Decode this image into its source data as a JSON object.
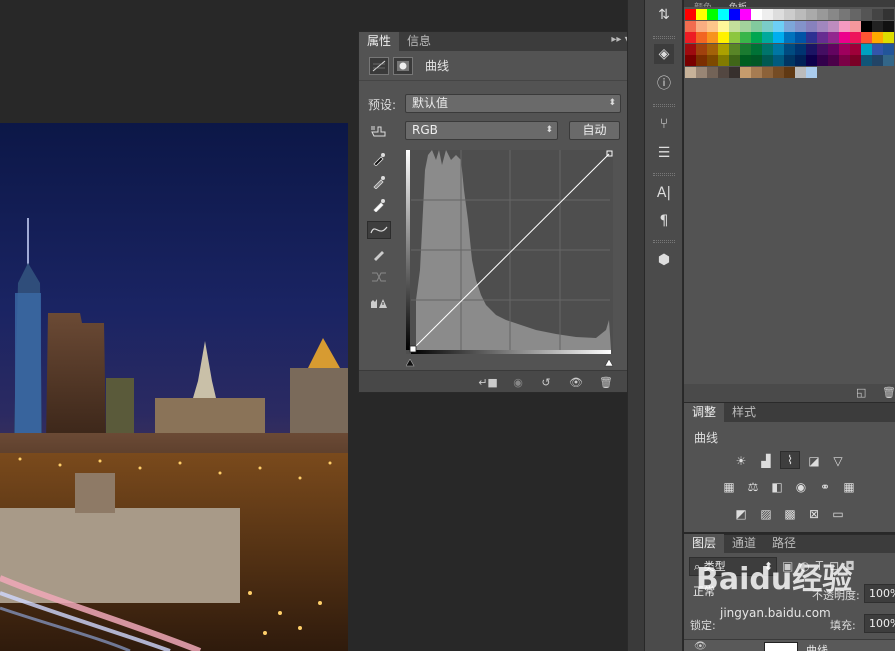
{
  "properties_panel": {
    "tabs": [
      {
        "label": "属性",
        "active": true
      },
      {
        "label": "信息",
        "active": false
      }
    ],
    "menu_icon": "panel-menu-icon",
    "title": "曲线",
    "preset_label": "预设:",
    "preset_value": "默认值",
    "channel_value": "RGB",
    "auto_button": "自动"
  },
  "swatches_panel": {
    "tabs": [
      {
        "label": "颜色"
      },
      {
        "label": "色板"
      }
    ]
  },
  "adjustments_panel": {
    "tabs": [
      {
        "label": "调整",
        "active": true
      },
      {
        "label": "样式",
        "active": false
      }
    ],
    "subtitle": "曲线"
  },
  "layers_panel": {
    "tabs": [
      {
        "label": "图层",
        "active": true
      },
      {
        "label": "通道",
        "active": false
      },
      {
        "label": "路径",
        "active": false
      }
    ],
    "filter_value": "类型",
    "blend_mode": "正常",
    "opacity_label": "不透明度:",
    "opacity_value": "100%",
    "lock_label": "锁定:",
    "fill_label": "填充:",
    "fill_value": "100%",
    "layer_name": "曲线"
  },
  "watermark": {
    "logo": "Baidu经验",
    "url": "jingyan.baidu.com"
  },
  "colors": {
    "panel_bg": "#535353",
    "tabbar_bg": "#3c3c3c",
    "app_bg": "#282828"
  }
}
